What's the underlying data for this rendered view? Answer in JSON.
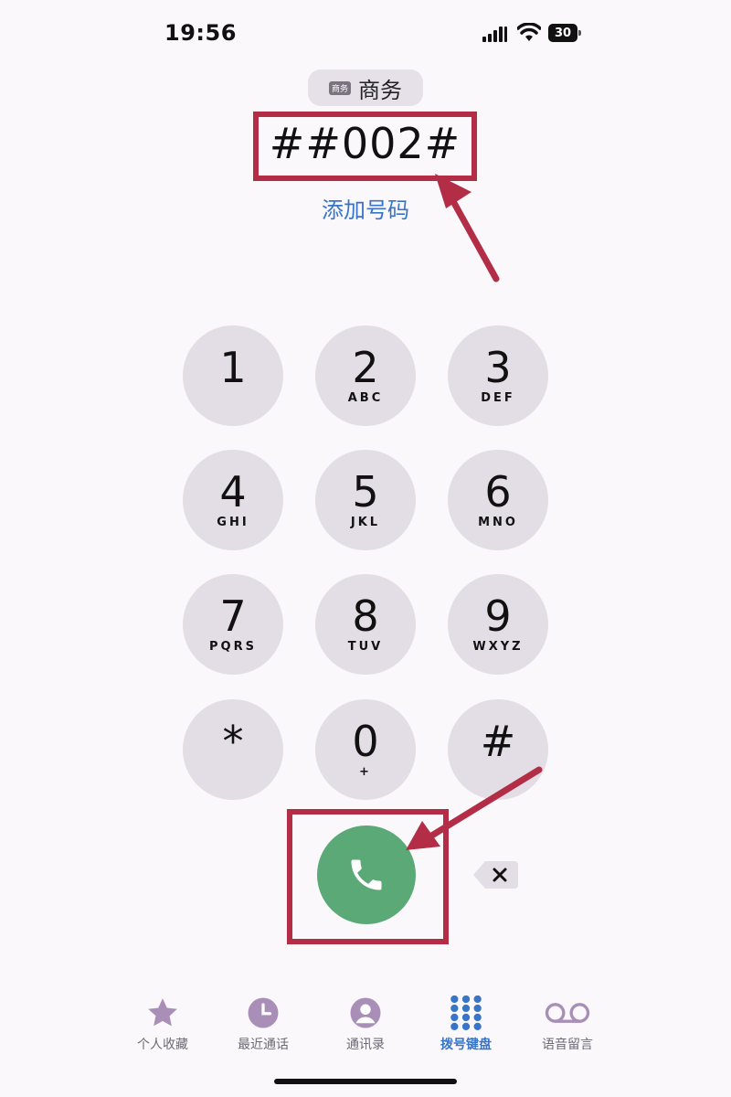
{
  "status_bar": {
    "time": "19:56",
    "battery": "30"
  },
  "line": {
    "tag": "商务",
    "name": "商务"
  },
  "dialer": {
    "number": "##002#",
    "add_number": "添加号码"
  },
  "keys": [
    {
      "digit": "1",
      "letters": ""
    },
    {
      "digit": "2",
      "letters": "ABC"
    },
    {
      "digit": "3",
      "letters": "DEF"
    },
    {
      "digit": "4",
      "letters": "GHI"
    },
    {
      "digit": "5",
      "letters": "JKL"
    },
    {
      "digit": "6",
      "letters": "MNO"
    },
    {
      "digit": "7",
      "letters": "PQRS"
    },
    {
      "digit": "8",
      "letters": "TUV"
    },
    {
      "digit": "9",
      "letters": "WXYZ"
    },
    {
      "digit": "*",
      "letters": ""
    },
    {
      "digit": "0",
      "letters": "+"
    },
    {
      "digit": "#",
      "letters": ""
    }
  ],
  "tabs": [
    {
      "label": "个人收藏",
      "icon": "star-icon"
    },
    {
      "label": "最近通话",
      "icon": "clock-icon"
    },
    {
      "label": "通讯录",
      "icon": "contact-icon"
    },
    {
      "label": "拨号键盘",
      "icon": "keypad-icon",
      "active": true
    },
    {
      "label": "语音留言",
      "icon": "voicemail-icon"
    }
  ],
  "colors": {
    "highlight": "#b22d45",
    "call": "#5aa977",
    "link": "#3874c8",
    "key": "#e3dde6",
    "tab_icon": "#a98fb8"
  }
}
